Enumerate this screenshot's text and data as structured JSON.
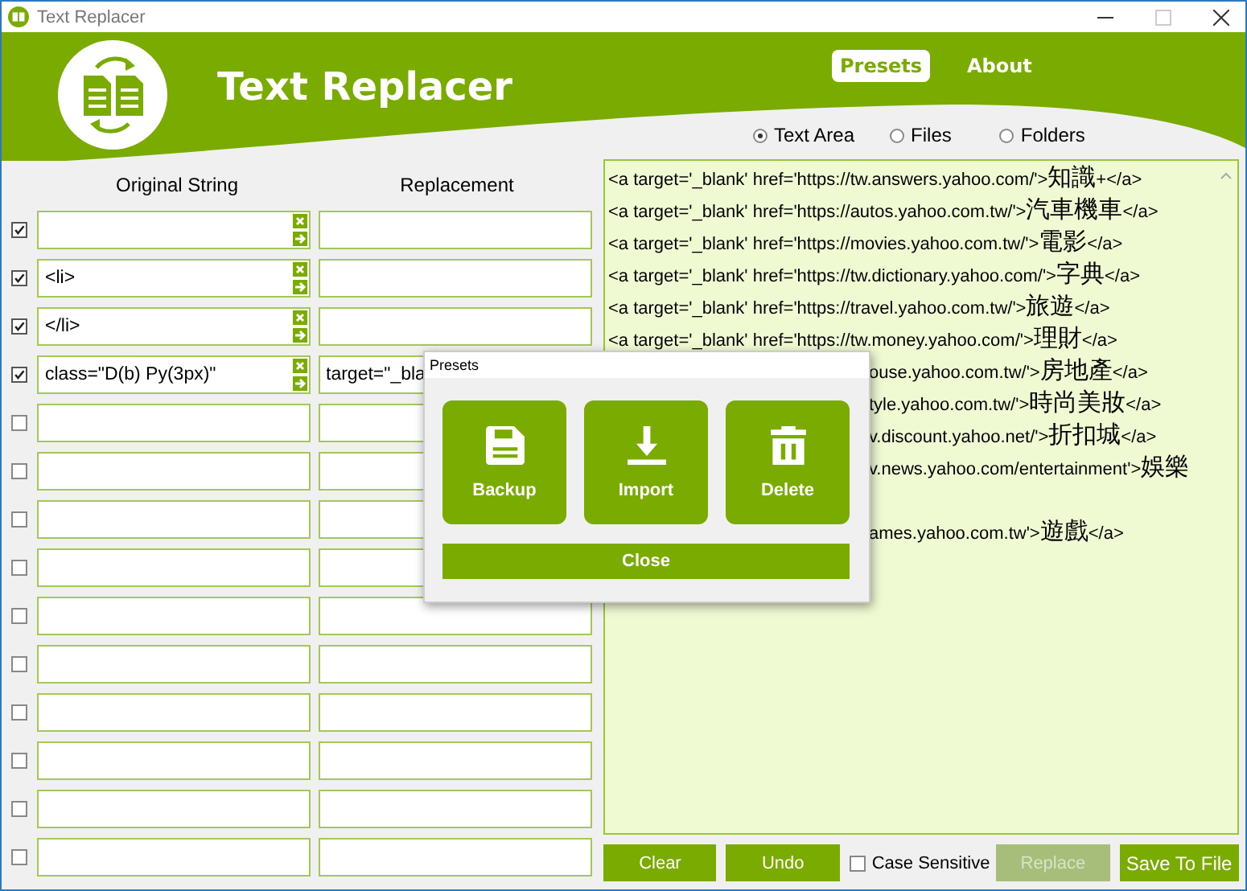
{
  "window": {
    "title": "Text Replacer"
  },
  "header": {
    "app_name": "Text Replacer",
    "nav": [
      {
        "label": "Presets",
        "selected": true
      },
      {
        "label": "About",
        "selected": false
      }
    ],
    "modes": [
      {
        "label": "Text Area",
        "selected": true
      },
      {
        "label": "Files",
        "selected": false
      },
      {
        "label": "Folders",
        "selected": false
      }
    ]
  },
  "columns": [
    "Original String",
    "Replacement"
  ],
  "rows": [
    {
      "checked": true,
      "original": ""
    },
    {
      "checked": true,
      "original": "<li>"
    },
    {
      "checked": true,
      "original": "</li>"
    },
    {
      "checked": true,
      "original": "class=\"D(b) Py(3px)\"",
      "replacement": "target=\"_bla"
    },
    {
      "checked": false
    },
    {
      "checked": false
    },
    {
      "checked": false
    },
    {
      "checked": false
    },
    {
      "checked": false
    },
    {
      "checked": false
    },
    {
      "checked": false
    },
    {
      "checked": false
    },
    {
      "checked": false
    },
    {
      "checked": false
    }
  ],
  "text_area": {
    "lines": [
      {
        "text": "<a target='_blank' href='https://tw.answers.yahoo.com/'>知識+</a>",
        "covered": false
      },
      {
        "text": "<a target='_blank' href='https://autos.yahoo.com.tw/'>汽車機車</a>",
        "covered": false
      },
      {
        "text": "<a target='_blank' href='https://movies.yahoo.com.tw/'>電影</a>",
        "covered": false
      },
      {
        "text": "<a target='_blank' href='https://tw.dictionary.yahoo.com/'>字典</a>",
        "covered": false
      },
      {
        "text": "<a target='_blank' href='https://travel.yahoo.com.tw/'>旅遊</a>",
        "covered": false
      },
      {
        "text": "<a target='_blank' href='https://tw.money.yahoo.com/'>理財</a>",
        "covered": false
      },
      {
        "text": "ouse.yahoo.com.tw/'>房地產</a>",
        "covered": true
      },
      {
        "text": "tyle.yahoo.com.tw/'>時尚美妝</a>",
        "covered": true
      },
      {
        "text": "v.discount.yahoo.net/'>折扣城</a>",
        "covered": true
      },
      {
        "text": "v.news.yahoo.com/entertainment'>娛樂",
        "covered": true
      },
      {
        "text": "ames.yahoo.com.tw'>遊戲</a>",
        "covered": true
      }
    ]
  },
  "buttons": [
    {
      "label": "Clear",
      "kind": "button",
      "disabled": false
    },
    {
      "label": "Undo",
      "kind": "button",
      "disabled": false
    },
    {
      "label": "Case Sensitive",
      "kind": "checkbox",
      "checked": false
    },
    {
      "label": "Replace",
      "kind": "button",
      "disabled": true
    },
    {
      "label": "Save To File",
      "kind": "button",
      "disabled": false
    }
  ],
  "dialog": {
    "title": "Presets",
    "actions": [
      {
        "label": "Backup",
        "kind": "save"
      },
      {
        "label": "Import",
        "kind": "import"
      },
      {
        "label": "Delete",
        "kind": "delete"
      }
    ],
    "close": "Close"
  }
}
